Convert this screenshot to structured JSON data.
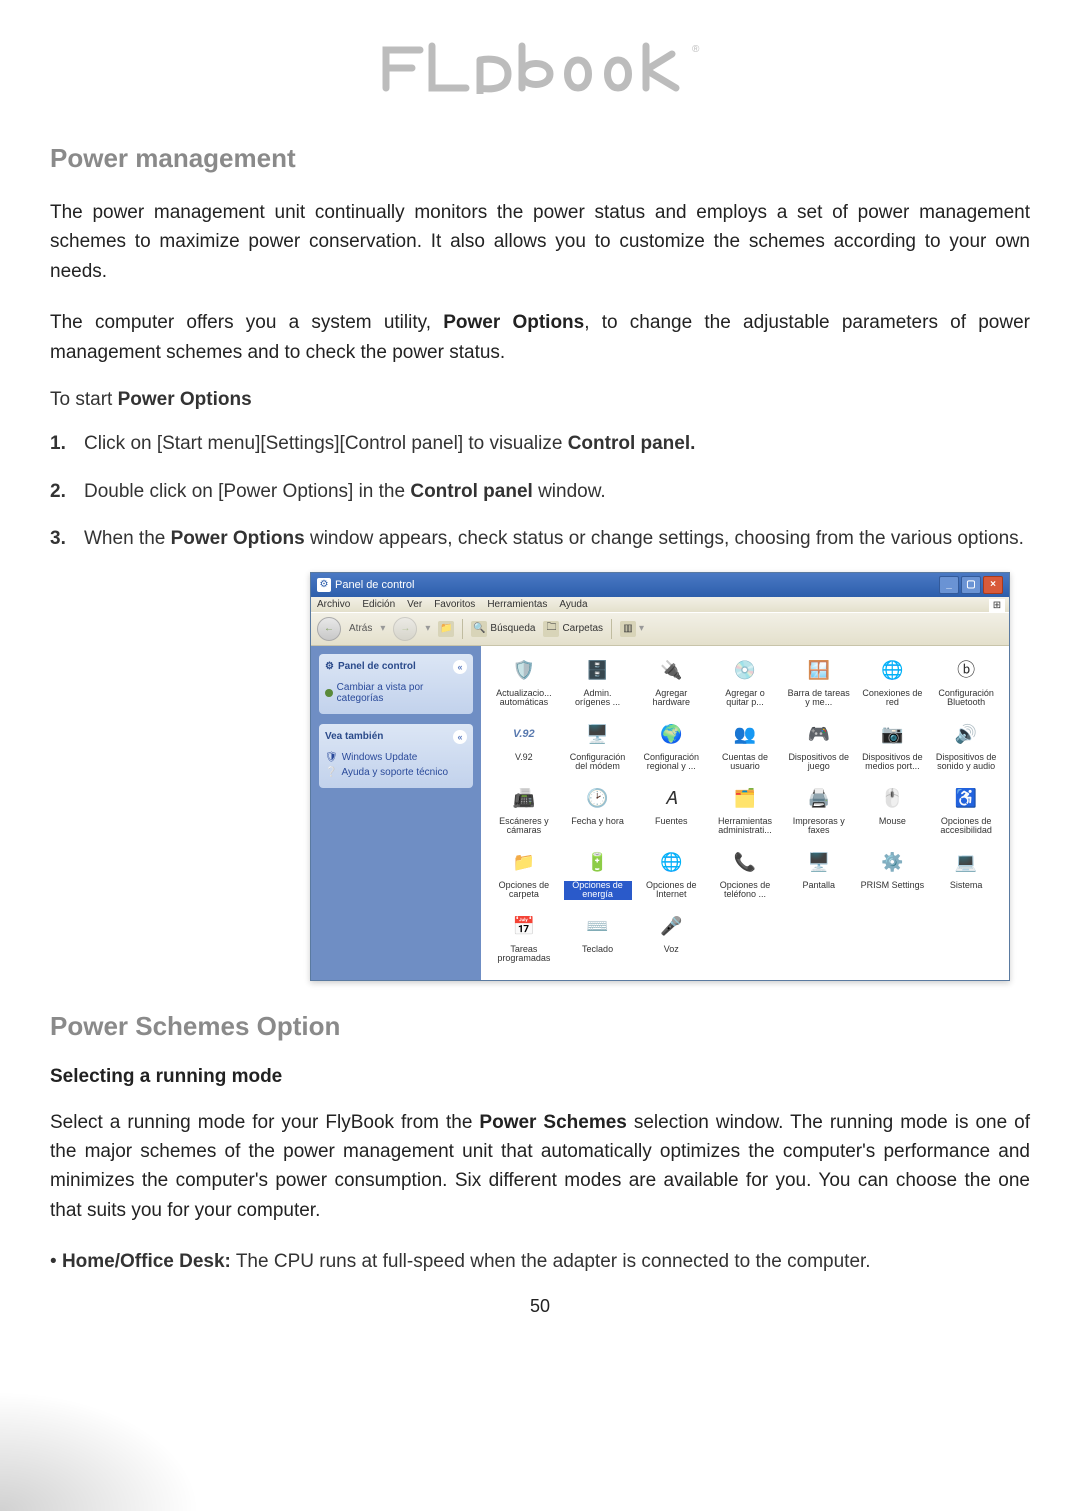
{
  "logo_text": "FLybook",
  "section1": {
    "heading": "Power management",
    "para1": "The power management unit continually monitors the power status and employs a set of power management schemes to maximize power conservation. It also allows you to customize the schemes according to your own needs.",
    "para2_pre": "The computer offers you a system utility, ",
    "para2_bold": "Power Options",
    "para2_post": ", to change the adjustable parameters of power management schemes and to check the power status.",
    "lead_pre": "To start ",
    "lead_bold": "Power Options",
    "steps": [
      {
        "num": "1.",
        "pre": "Click on [Start menu][Settings][Control panel] to visualize ",
        "bold": "Control panel.",
        "post": ""
      },
      {
        "num": "2.",
        "pre": "Double click on [Power Options] in the ",
        "bold": "Control panel",
        "post": " window."
      },
      {
        "num": "3.",
        "pre": "When the ",
        "bold": "Power Options",
        "post": " window appears, check status or change settings, choosing from the various options."
      }
    ]
  },
  "control_panel": {
    "title": "Panel de control",
    "menus": [
      "Archivo",
      "Edición",
      "Ver",
      "Favoritos",
      "Herramientas",
      "Ayuda"
    ],
    "toolbar": {
      "back": "Atrás",
      "search": "Búsqueda",
      "folders": "Carpetas",
      "views_icon": "▥"
    },
    "sidebar": {
      "box1": {
        "title": "Panel de control",
        "link": "Cambiar a vista por categorías"
      },
      "box2": {
        "title": "Vea también",
        "links": [
          "Windows Update",
          "Ayuda y soporte técnico"
        ]
      }
    },
    "items": [
      {
        "label": "Actualizacio... automáticas",
        "ico": "🛡️"
      },
      {
        "label": "Admin. orígenes ...",
        "ico": "🗄️"
      },
      {
        "label": "Agregar hardware",
        "ico": "🔌"
      },
      {
        "label": "Agregar o quitar p...",
        "ico": "💿"
      },
      {
        "label": "Barra de tareas y me...",
        "ico": "🪟"
      },
      {
        "label": "Conexiones de red",
        "ico": "🌐"
      },
      {
        "label": "Configuración Bluetooth",
        "ico": "ⓑ"
      },
      {
        "label": "V.92",
        "ico": "V.92",
        "text_icon": true
      },
      {
        "label": "Configuración del módem",
        "ico": "🖥️"
      },
      {
        "label": "Configuración regional y ...",
        "ico": "🌍"
      },
      {
        "label": "Cuentas de usuario",
        "ico": "👥"
      },
      {
        "label": "Dispositivos de juego",
        "ico": "🎮"
      },
      {
        "label": "Dispositivos de medios port...",
        "ico": "📷"
      },
      {
        "label": "Dispositivos de sonido y audio",
        "ico": "🔊"
      },
      {
        "label": "Escáneres y cámaras",
        "ico": "📠"
      },
      {
        "label": "Fecha y hora",
        "ico": "🕑"
      },
      {
        "label": "Fuentes",
        "ico": "𝐴"
      },
      {
        "label": "Herramientas administrati...",
        "ico": "🗂️"
      },
      {
        "label": "Impresoras y faxes",
        "ico": "🖨️"
      },
      {
        "label": "Mouse",
        "ico": "🖱️"
      },
      {
        "label": "Opciones de accesibilidad",
        "ico": "♿"
      },
      {
        "label": "Opciones de carpeta",
        "ico": "📁"
      },
      {
        "label": "Opciones de energía",
        "ico": "🔋",
        "highlight": true
      },
      {
        "label": "Opciones de Internet",
        "ico": "🌐"
      },
      {
        "label": "Opciones de teléfono ...",
        "ico": "📞"
      },
      {
        "label": "Pantalla",
        "ico": "🖥️"
      },
      {
        "label": "PRISM Settings",
        "ico": "⚙️"
      },
      {
        "label": "Sistema",
        "ico": "💻"
      },
      {
        "label": "Tareas programadas",
        "ico": "📅"
      },
      {
        "label": "Teclado",
        "ico": "⌨️"
      },
      {
        "label": "Voz",
        "ico": "🎤"
      }
    ]
  },
  "section2": {
    "heading": "Power Schemes Option",
    "subheading": "Selecting a running mode",
    "para_pre": "Select a running mode for your FlyBook from the ",
    "para_bold": "Power Schemes",
    "para_post": " selection window. The running mode is one of the major schemes of the power management unit that automatically optimizes the computer's performance and minimizes the computer's power consumption. Six different modes are available for you. You can choose the one that suits you for your computer.",
    "bullet_label": "Home/Office Desk:",
    "bullet_text": " The CPU runs at full-speed when the adapter is connected to the computer."
  },
  "page_number": "50"
}
